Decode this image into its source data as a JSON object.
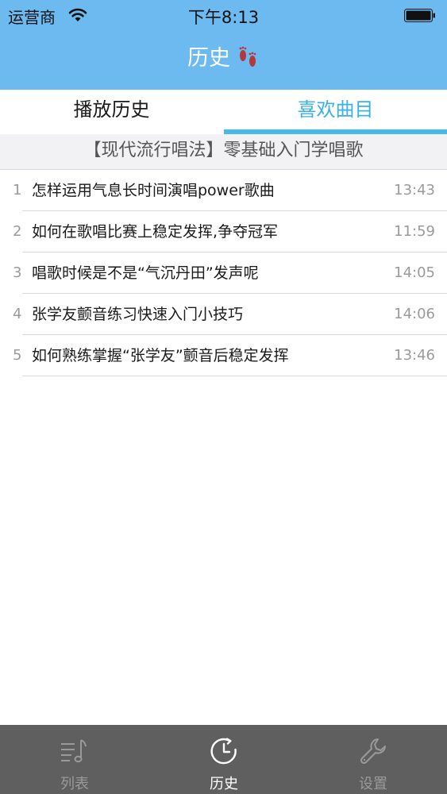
{
  "status_bar": {
    "carrier": "运营商",
    "time": "下午8:13"
  },
  "nav": {
    "title": "历史",
    "title_icon": "footprints-icon"
  },
  "tabs": [
    {
      "label": "播放历史",
      "active": false
    },
    {
      "label": "喜欢曲目",
      "active": true
    }
  ],
  "album": {
    "title": "【现代流行唱法】零基础入门学唱歌"
  },
  "items": [
    {
      "index": "1",
      "title": "怎样运用气息长时间演唱power歌曲",
      "time": "13:43"
    },
    {
      "index": "2",
      "title": "如何在歌唱比赛上稳定发挥,争夺冠军",
      "time": "11:59"
    },
    {
      "index": "3",
      "title": "唱歌时候是不是“气沉丹田”发声呢",
      "time": "14:05"
    },
    {
      "index": "4",
      "title": "张学友颤音练习快速入门小技巧",
      "time": "14:06"
    },
    {
      "index": "5",
      "title": "如何熟练掌握“张学友”颤音后稳定发挥",
      "time": "13:46"
    }
  ],
  "tabbar": [
    {
      "label": "列表",
      "icon": "music-list-icon",
      "active": false
    },
    {
      "label": "历史",
      "icon": "clock-icon",
      "active": true
    },
    {
      "label": "设置",
      "icon": "wrench-icon",
      "active": false
    }
  ],
  "colors": {
    "header": "#6cbaf0",
    "accent": "#3ab1e6",
    "tabbar": "#5f5f5f"
  }
}
